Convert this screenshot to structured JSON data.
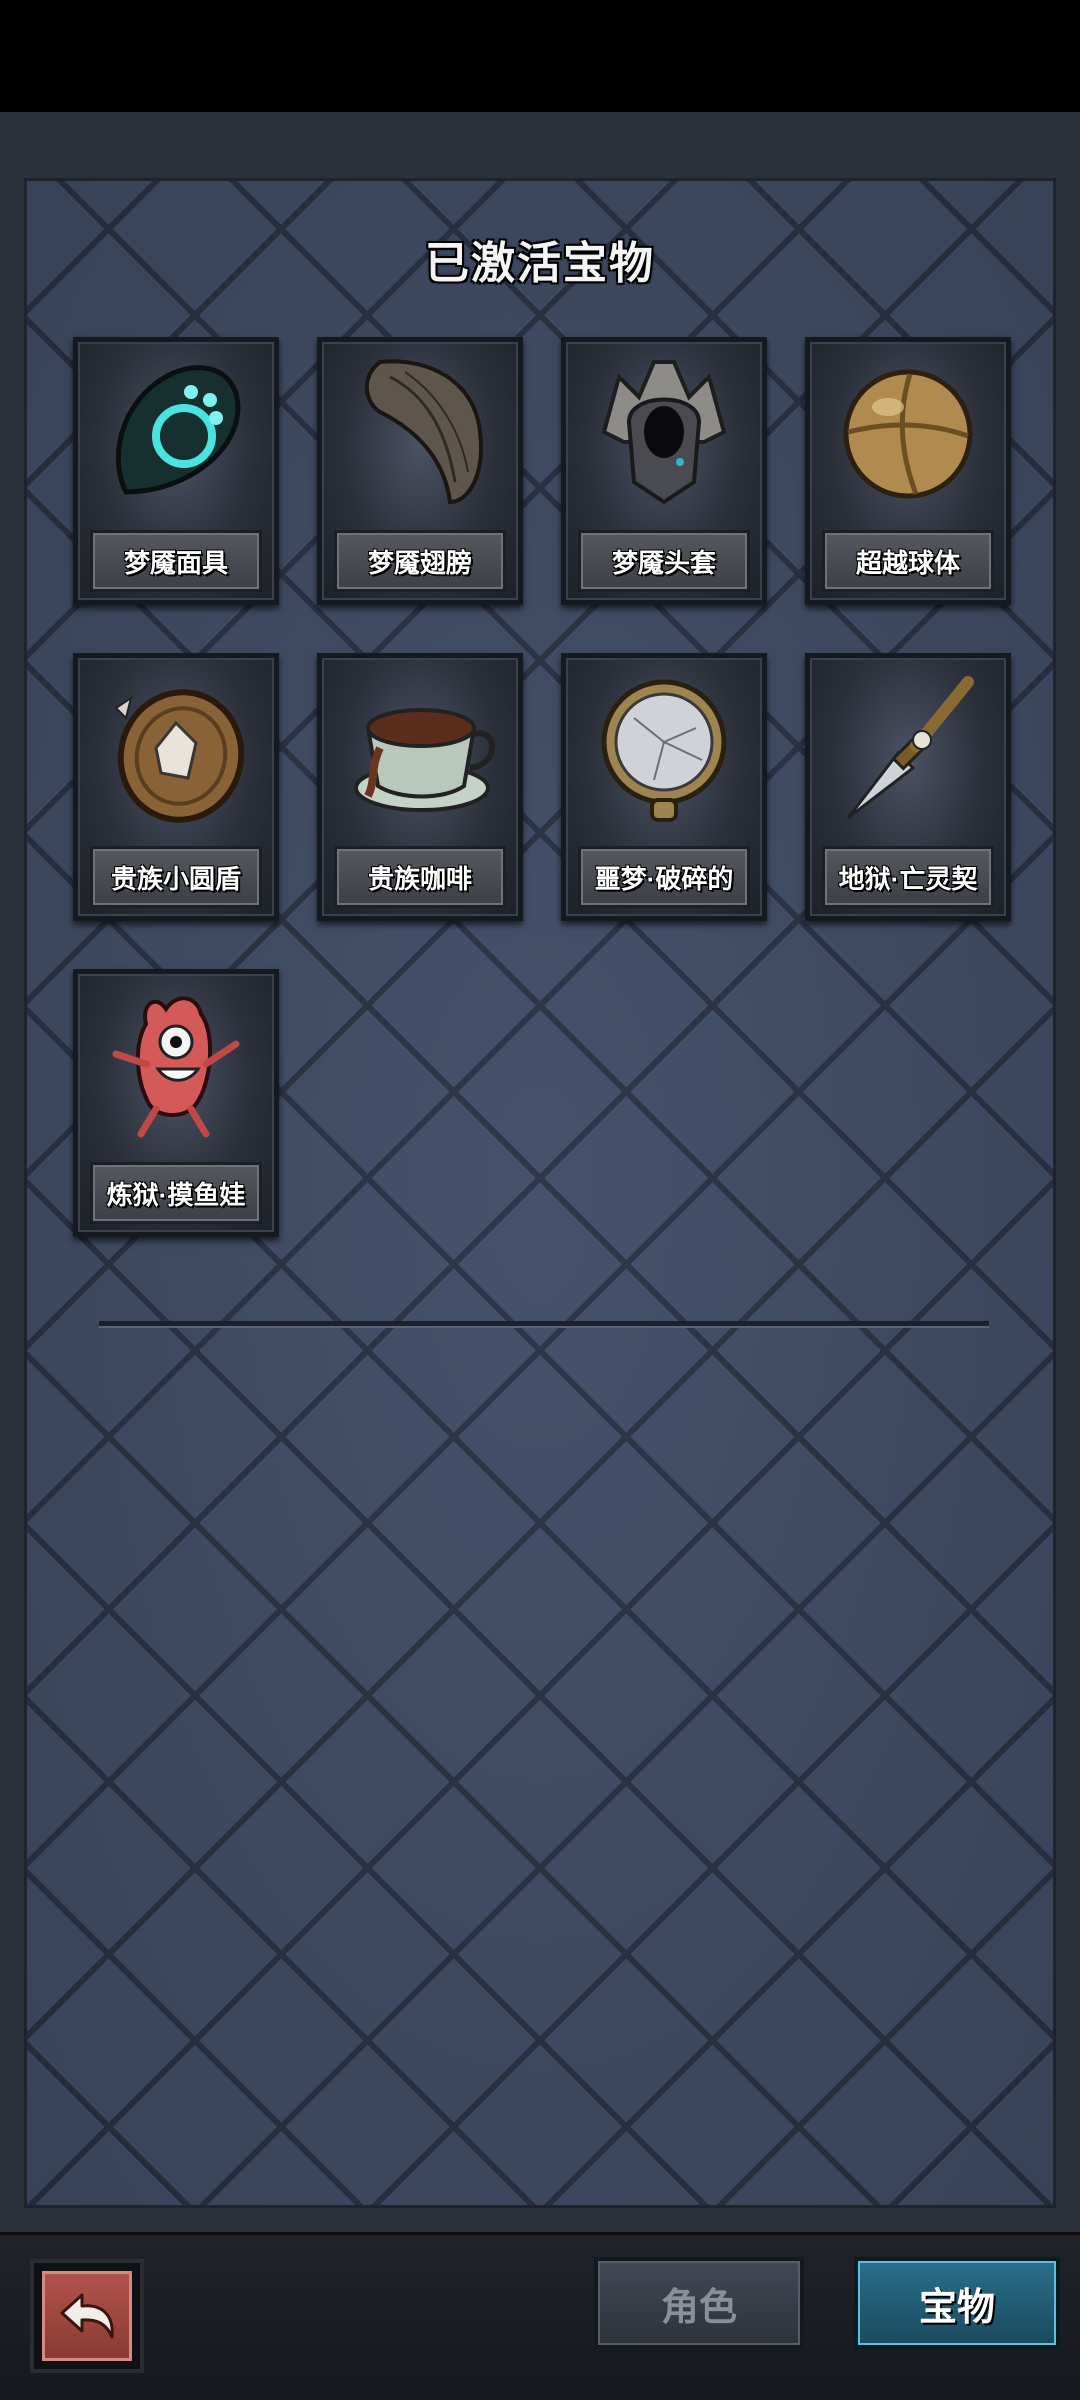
{
  "panel": {
    "title": "已激活宝物"
  },
  "treasures": [
    {
      "name": "梦魇面具",
      "icon": "nightmare-mask-icon"
    },
    {
      "name": "梦魇翅膀",
      "icon": "nightmare-wing-icon"
    },
    {
      "name": "梦魇头套",
      "icon": "nightmare-helmet-icon"
    },
    {
      "name": "超越球体",
      "icon": "transcendent-sphere-icon"
    },
    {
      "name": "贵族小圆盾",
      "icon": "noble-buckler-icon"
    },
    {
      "name": "贵族咖啡",
      "icon": "noble-coffee-icon"
    },
    {
      "name": "噩梦·破碎的",
      "icon": "broken-pocket-watch-icon"
    },
    {
      "name": "地狱·亡灵契",
      "icon": "undead-dagger-icon"
    },
    {
      "name": "炼狱·摸鱼娃",
      "icon": "pink-creature-doll-icon"
    }
  ],
  "tabs": {
    "role_label": "角色",
    "treasure_label": "宝物",
    "active": "宝物"
  },
  "colors": {
    "panel_bg": "#44506a",
    "active_tab": "#2a6f8a",
    "back_button": "#9c463e"
  }
}
